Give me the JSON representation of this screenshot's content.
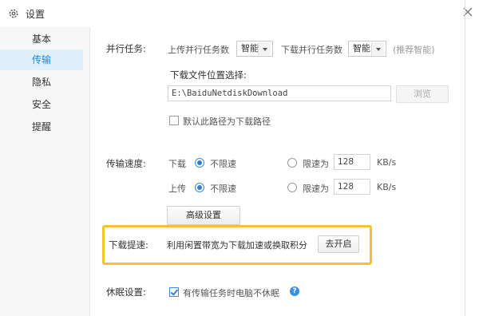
{
  "window": {
    "title": "设置"
  },
  "sidebar": {
    "items": [
      {
        "label": "基本"
      },
      {
        "label": "传输"
      },
      {
        "label": "隐私"
      },
      {
        "label": "安全"
      },
      {
        "label": "提醒"
      }
    ],
    "active": "传输"
  },
  "parallel": {
    "section_label": "并行任务:",
    "upload_label": "上传并行任务数",
    "upload_value": "智能",
    "download_label": "下载并行任务数",
    "download_value": "智能",
    "hint": "(推荐智能)"
  },
  "download_location": {
    "label": "下载文件位置选择:",
    "path": "E:\\BaiduNetdiskDownload",
    "browse_button": "浏览",
    "default_checkbox_label": "默认此路径为下载路径",
    "default_checked": false
  },
  "speed": {
    "section_label": "传输速度:",
    "download_label": "下载",
    "upload_label": "上传",
    "unlimited_label": "不限速",
    "limit_label": "限速为",
    "download_limit_value": "128",
    "upload_limit_value": "128",
    "unit": "KB/s",
    "download_mode": "unlimited",
    "upload_mode": "unlimited",
    "advanced_button": "高级设置"
  },
  "boost": {
    "section_label": "下载提速:",
    "description": "利用闲置带宽为下载加速或换取积分",
    "enable_button": "去开启"
  },
  "sleep": {
    "section_label": "休眠设置:",
    "checkbox_label": "有传输任务时电脑不休眠",
    "checked": true,
    "help_glyph": "?"
  },
  "colors": {
    "accent": "#1e88d9",
    "sidebar_active_bg": "#dff0fb",
    "highlight_border": "#f3c230"
  },
  "icons": {
    "title_icon": "gear-icon",
    "close_icon": "close-icon",
    "help_icon": "help-circle-icon"
  }
}
